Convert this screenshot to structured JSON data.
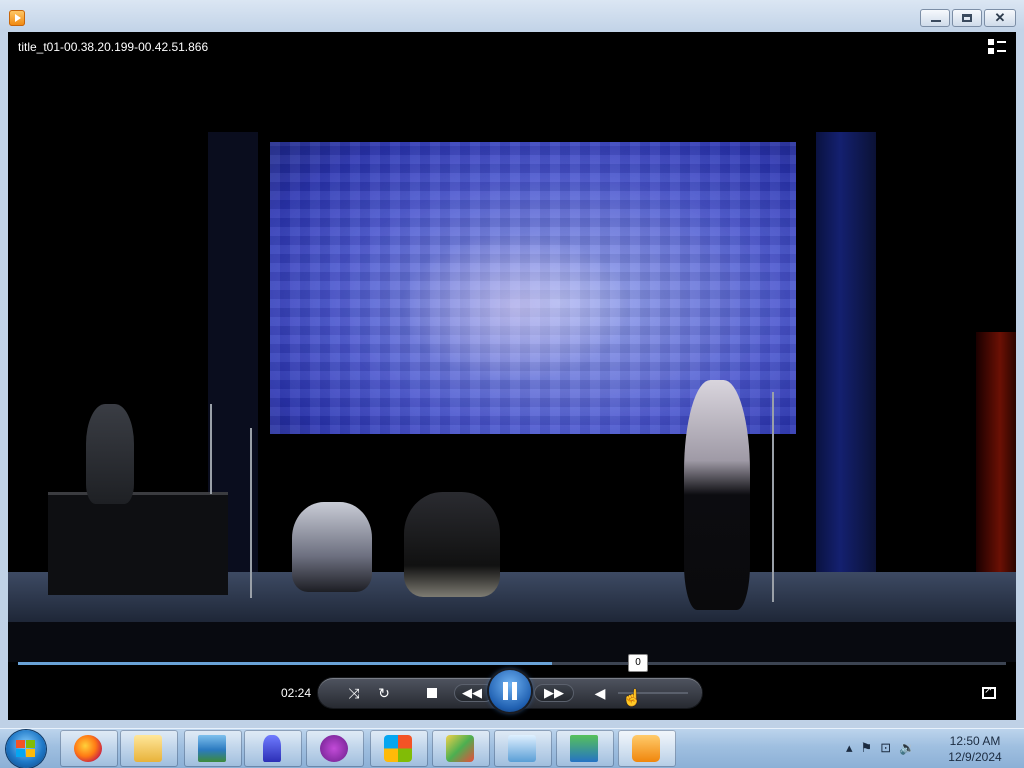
{
  "window": {
    "title": "",
    "controls": {
      "minimize": "minimize",
      "maximize": "maximize",
      "close": "✕"
    }
  },
  "video": {
    "title": "title_t01-00.38.20.199-00.42.51.866"
  },
  "player": {
    "elapsed": "02:24",
    "progress": 0.54,
    "volume_tooltip": "0",
    "buttons": [
      "shuffle",
      "repeat",
      "stop",
      "previous",
      "pause",
      "next",
      "mute"
    ]
  },
  "taskbar": {
    "items": [
      "Firefox",
      "Windows Explorer",
      "Photo Viewer",
      "Inkscape",
      "Mask app",
      "Windows",
      "Media Center",
      "Control Panel",
      "Desktop Manager",
      "Windows Media Player"
    ],
    "clock": {
      "time": "12:50 AM",
      "date": "12/9/2024"
    }
  }
}
